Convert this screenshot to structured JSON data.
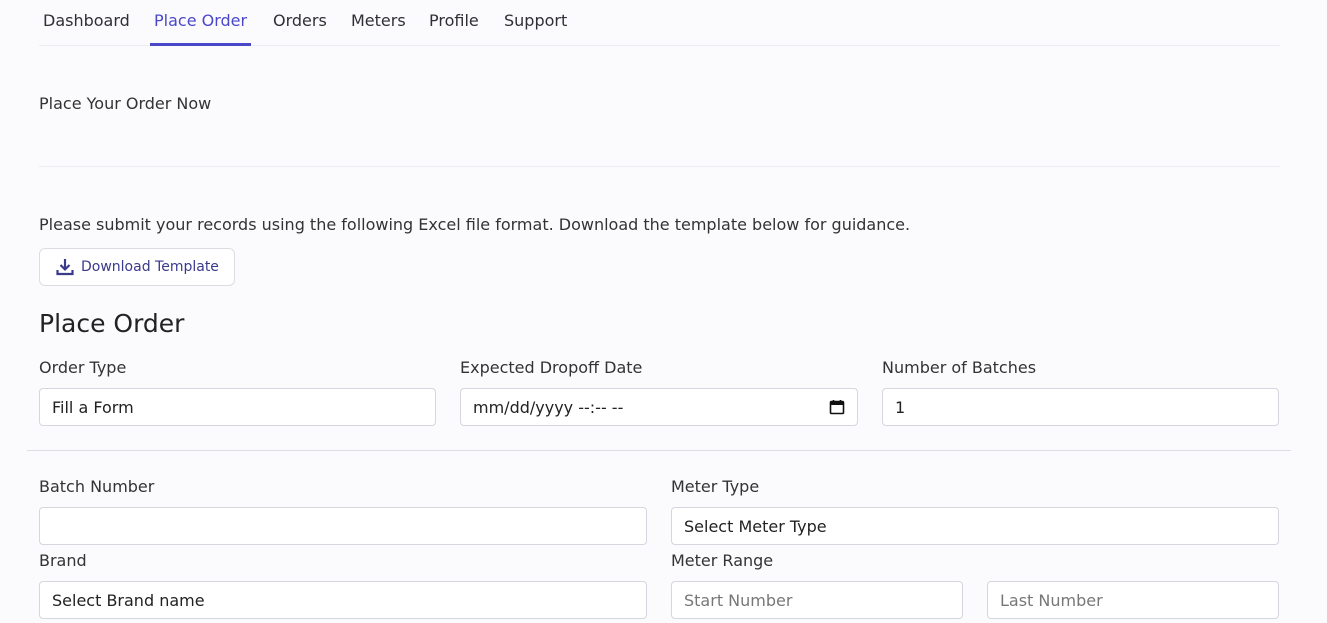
{
  "nav": {
    "tabs": [
      {
        "label": "Dashboard"
      },
      {
        "label": "Place Order"
      },
      {
        "label": "Orders"
      },
      {
        "label": "Meters"
      },
      {
        "label": "Profile"
      },
      {
        "label": "Support"
      }
    ],
    "active_tab": "Place Order"
  },
  "header": {
    "section_title": "Place Your Order Now"
  },
  "instructions": {
    "text": "Please submit your records using the following Excel file format. Download the template below for guidance.",
    "download_button_label": "Download Template",
    "download_icon": "download-icon"
  },
  "form": {
    "title": "Place Order",
    "order_type": {
      "label": "Order Type",
      "value": "Fill a Form"
    },
    "dropoff_date": {
      "label": "Expected Dropoff Date",
      "value": "mm/dd/yyyy --:-- --",
      "icon": "calendar-icon"
    },
    "num_batches": {
      "label": "Number of Batches",
      "value": "1"
    },
    "batch_number": {
      "label": "Batch Number",
      "value": ""
    },
    "meter_type": {
      "label": "Meter Type",
      "value": "Select Meter Type"
    },
    "brand": {
      "label": "Brand",
      "value": "Select Brand name"
    },
    "meter_range": {
      "label": "Meter Range",
      "start_placeholder": "Start Number",
      "end_placeholder": "Last Number"
    }
  },
  "colors": {
    "accent": "#4a48c9",
    "background": "#fbfbfe"
  }
}
